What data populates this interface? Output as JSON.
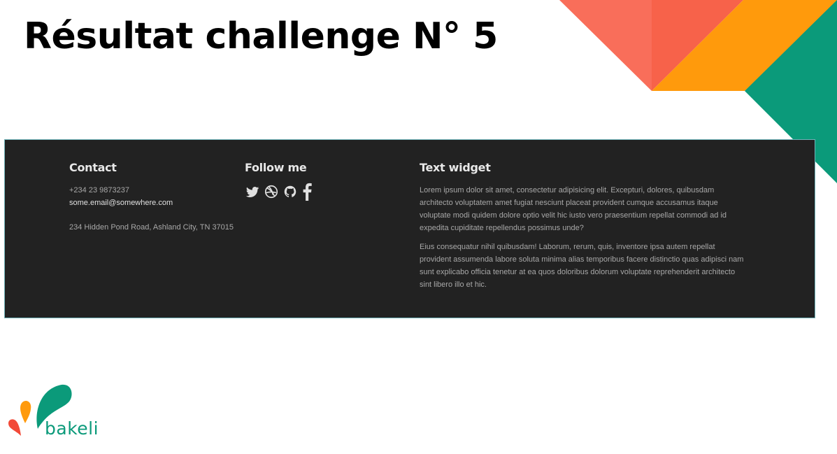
{
  "slide": {
    "title": "Résultat challenge N° 5"
  },
  "footer": {
    "contact": {
      "heading": "Contact",
      "phone": "+234 23 9873237",
      "email": "some.email@somewhere.com",
      "address": "234 Hidden Pond Road, Ashland City, TN 37015"
    },
    "follow": {
      "heading": "Follow me",
      "icons": [
        "twitter-icon",
        "dribbble-icon",
        "github-icon",
        "facebook-icon"
      ]
    },
    "text_widget": {
      "heading": "Text widget",
      "paragraphs": [
        "Lorem ipsum dolor sit amet, consectetur adipisicing elit. Excepturi, dolores, quibusdam architecto voluptatem amet fugiat nesciunt placeat provident cumque accusamus itaque voluptate modi quidem dolore optio velit hic iusto vero praesentium repellat commodi ad id expedita cupiditate repellendus possimus unde?",
        "Eius consequatur nihil quibusdam! Laborum, rerum, quis, inventore ipsa autem repellat provident assumenda labore soluta minima alias temporibus facere distinctio quas adipisci nam sunt explicabo officia tenetur at ea quos doloribus dolorum voluptate reprehenderit architecto sint libero illo et hic."
      ]
    }
  },
  "brand": {
    "logo_text": "bakeli"
  },
  "colors": {
    "coral": "#f96e5a",
    "orange": "#ff9a0c",
    "green": "#0b9a7a",
    "footer_bg": "#222222"
  }
}
